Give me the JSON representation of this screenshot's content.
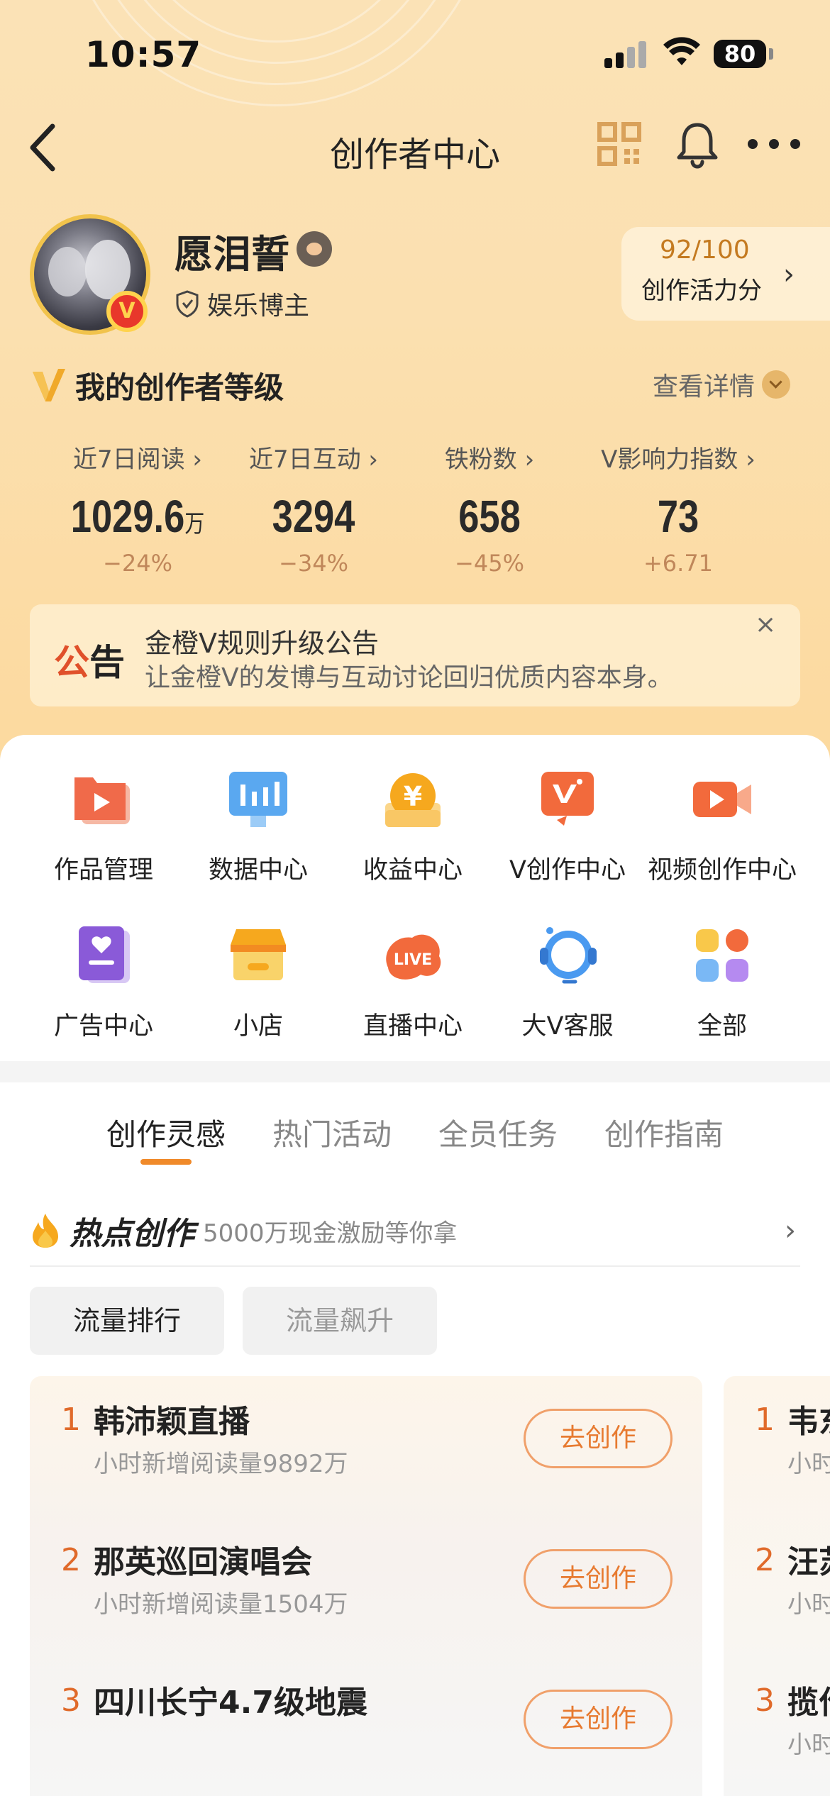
{
  "status_bar": {
    "time": "10:57",
    "battery": "80"
  },
  "nav": {
    "title": "创作者中心"
  },
  "profile": {
    "name": "愿泪誓",
    "role": "娱乐博主",
    "vbadge": "V",
    "activity_score": "92/100",
    "activity_label": "创作活力分"
  },
  "level": {
    "title": "我的创作者等级",
    "detail_link": "查看详情"
  },
  "stats": [
    {
      "label": "近7日阅读",
      "value": "1029.6",
      "unit": "万",
      "change": "−24%"
    },
    {
      "label": "近7日互动",
      "value": "3294",
      "unit": "",
      "change": "−34%"
    },
    {
      "label": "铁粉数",
      "value": "658",
      "unit": "",
      "change": "−45%"
    },
    {
      "label": "V影响力指数",
      "value": "73",
      "unit": "",
      "change": "+6.71"
    }
  ],
  "notice": {
    "tag_a": "公",
    "tag_b": "告",
    "title": "金橙V规则升级公告",
    "body": "让金橙V的发博与互动讨论回归优质内容本身。",
    "close": "×"
  },
  "tools": [
    {
      "label": "作品管理",
      "icon": "folder-play-icon"
    },
    {
      "label": "数据中心",
      "icon": "bar-chart-icon"
    },
    {
      "label": "收益中心",
      "icon": "yen-coin-icon"
    },
    {
      "label": "V创作中心",
      "icon": "v-sparkle-icon"
    },
    {
      "label": "视频创作中心",
      "icon": "video-camera-icon"
    },
    {
      "label": "广告中心",
      "icon": "ad-book-icon"
    },
    {
      "label": "小店",
      "icon": "shop-icon"
    },
    {
      "label": "直播中心",
      "icon": "live-icon"
    },
    {
      "label": "大V客服",
      "icon": "headset-icon"
    },
    {
      "label": "全部",
      "icon": "grid-icon"
    }
  ],
  "tabs": [
    "创作灵感",
    "热门活动",
    "全员任务",
    "创作指南"
  ],
  "hot": {
    "title": "热点创作",
    "subtitle": "5000万现金激励等你拿"
  },
  "chips": [
    "流量排行",
    "流量飙升"
  ],
  "ranking": [
    {
      "rank": "1",
      "title": "韩沛颖直播",
      "sub": "小时新增阅读量9892万",
      "button": "去创作"
    },
    {
      "rank": "2",
      "title": "那英巡回演唱会",
      "sub": "小时新增阅读量1504万",
      "button": "去创作"
    },
    {
      "rank": "3",
      "title": "四川长宁4.7级地震",
      "sub": "",
      "button": "去创作"
    }
  ],
  "ranking2": [
    {
      "rank": "1",
      "title": "韦东",
      "sub": "小时"
    },
    {
      "rank": "2",
      "title": "汪苏",
      "sub": "小时"
    },
    {
      "rank": "3",
      "title": "揽作",
      "sub": "小时"
    }
  ],
  "colors": {
    "accent": "#f08a2a",
    "header_bg": "#fbe0b0",
    "rank_num": "#e06a2a"
  }
}
